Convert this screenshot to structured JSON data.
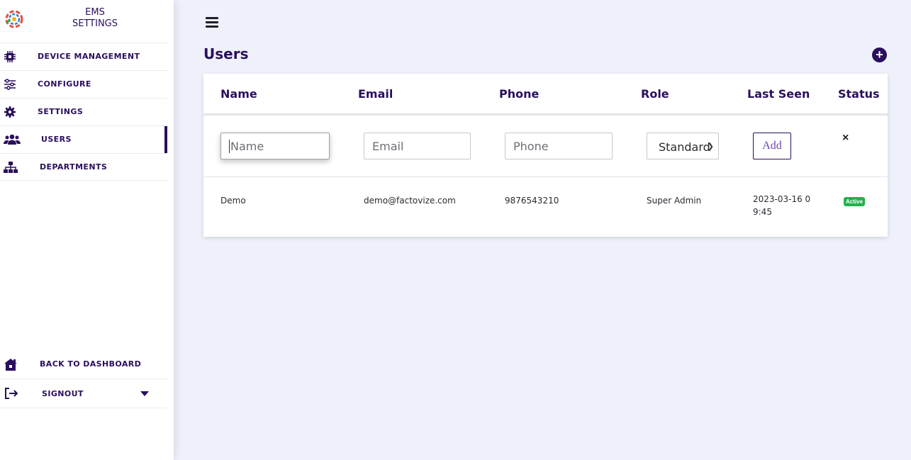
{
  "sidebar": {
    "brand": [
      "EMS",
      "SETTINGS"
    ],
    "items": [
      {
        "label": "DEVICE MANAGEMENT",
        "icon": "chip-icon"
      },
      {
        "label": "CONFIGURE",
        "icon": "sliders-icon"
      },
      {
        "label": "SETTINGS",
        "icon": "gear-icon"
      },
      {
        "label": "USERS",
        "icon": "users-icon",
        "active": true
      },
      {
        "label": "DEPARTMENTS",
        "icon": "org-chart-icon"
      }
    ],
    "bottom": [
      {
        "label": "BACK TO DASHBOARD",
        "icon": "home-icon"
      },
      {
        "label": "SIGNOUT",
        "icon": "signout-icon"
      }
    ]
  },
  "main": {
    "title": "Users",
    "columns": [
      "Name",
      "Email",
      "Phone",
      "Role",
      "Last Seen",
      "Status"
    ],
    "form": {
      "name_placeholder": "Name",
      "email_placeholder": "Email",
      "phone_placeholder": "Phone",
      "role_selected": "Standard",
      "add_label": "Add",
      "close_label": "×"
    },
    "rows": [
      {
        "name": "Demo",
        "email": "demo@factovize.com",
        "phone": "9876543210",
        "role": "Super Admin",
        "last_seen": [
          "2023-03-16 0",
          "9:45"
        ],
        "status": "Active"
      }
    ]
  },
  "colors": {
    "accent": "#2a0f5c",
    "background": "#eef0fa",
    "active_badge": "#22b14c"
  }
}
